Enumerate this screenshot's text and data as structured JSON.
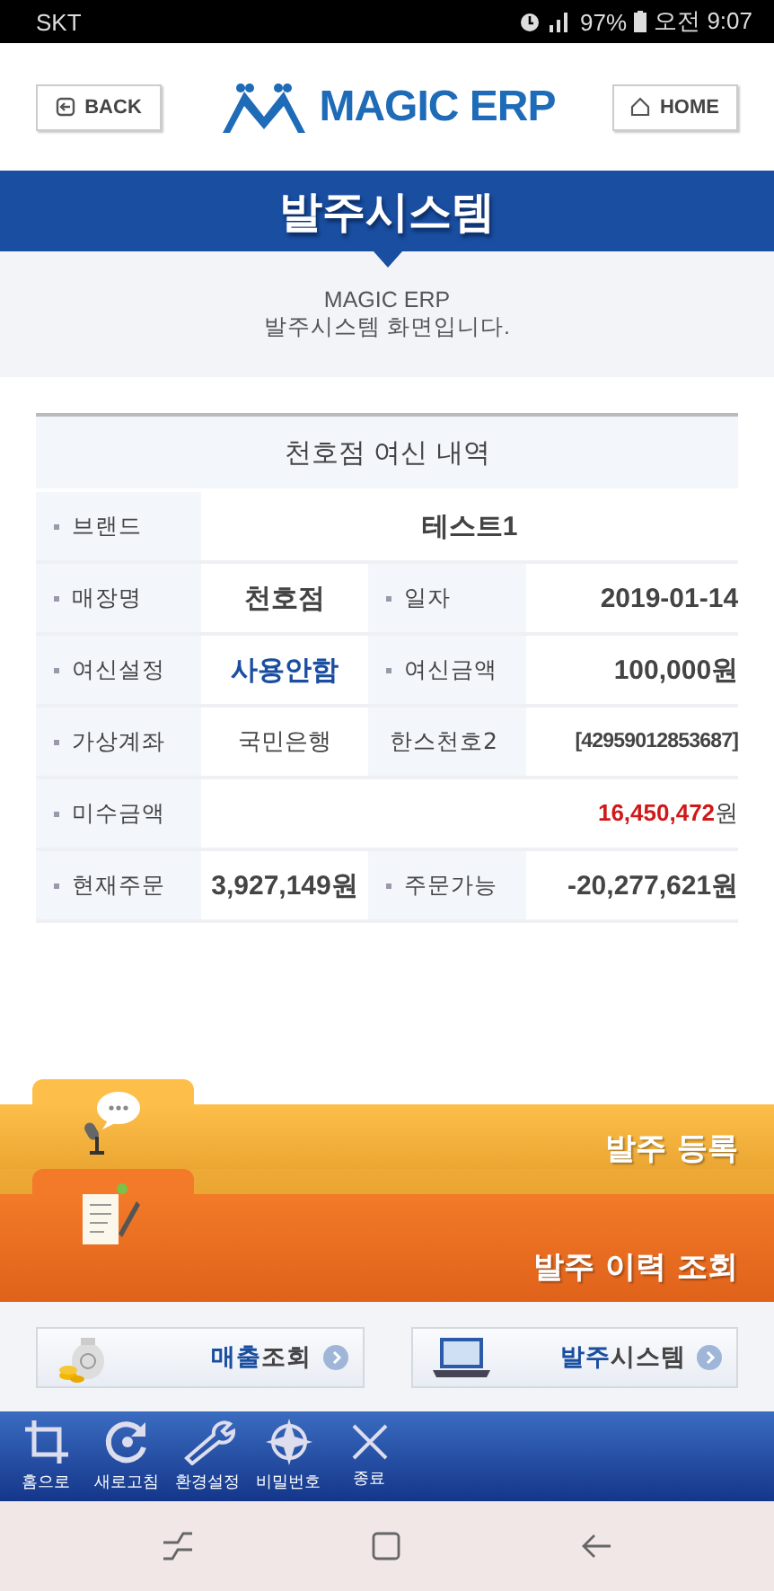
{
  "status_bar": {
    "carrier": "SKT",
    "battery": "97%",
    "time": "오전 9:07"
  },
  "header": {
    "back": "BACK",
    "logo": "MAGIC ERP",
    "home": "HOME"
  },
  "banner": {
    "title": "발주시스템"
  },
  "intro": {
    "line1": "MAGIC ERP",
    "line2": "발주시스템 화면입니다."
  },
  "table": {
    "title": "천호점 여신 내역",
    "rows": [
      {
        "cells": [
          {
            "kind": "label",
            "text": "브랜드"
          },
          {
            "kind": "value",
            "text": "테스트1",
            "colspan": 3
          }
        ]
      },
      {
        "cells": [
          {
            "kind": "label",
            "text": "매장명"
          },
          {
            "kind": "value",
            "text": "천호점"
          },
          {
            "kind": "label",
            "text": "일자"
          },
          {
            "kind": "value",
            "text": "2019-01-14"
          }
        ]
      },
      {
        "cells": [
          {
            "kind": "label",
            "text": "여신설정"
          },
          {
            "kind": "status",
            "text": "사용안함"
          },
          {
            "kind": "label",
            "text": "여신금액"
          },
          {
            "kind": "value",
            "text": "100,000원"
          }
        ]
      },
      {
        "cells": [
          {
            "kind": "label",
            "text": "가상계좌"
          },
          {
            "kind": "plain",
            "text": "국민은행"
          },
          {
            "kind": "sublabel",
            "text": "한스천호2"
          },
          {
            "kind": "account",
            "text": "[42959012853687]"
          }
        ]
      },
      {
        "cells": [
          {
            "kind": "label",
            "text": "미수금액"
          },
          {
            "kind": "alert",
            "text": "16,450,472",
            "unit": "원",
            "colspan": 3
          }
        ]
      },
      {
        "cells": [
          {
            "kind": "label",
            "text": "현재주문"
          },
          {
            "kind": "value",
            "text": "3,927,149원"
          },
          {
            "kind": "label",
            "text": "주문가능"
          },
          {
            "kind": "value",
            "text": "-20,277,621원"
          }
        ]
      }
    ]
  },
  "menu_tabs": [
    {
      "label": "발주 등록",
      "kind": "register"
    },
    {
      "label": "발주 이력 조회",
      "kind": "history"
    }
  ],
  "quick_buttons": [
    {
      "highlight": "매출",
      "rest": "조회",
      "kind": "sales"
    },
    {
      "highlight": "발주",
      "rest": "시스템",
      "kind": "system"
    }
  ],
  "toolbar": [
    {
      "label": "홈으로",
      "kind": "crop"
    },
    {
      "label": "새로고침",
      "kind": "refresh"
    },
    {
      "label": "환경설정",
      "kind": "settings"
    },
    {
      "label": "비밀번호",
      "kind": "compass"
    },
    {
      "label": "종료",
      "kind": "close"
    }
  ]
}
